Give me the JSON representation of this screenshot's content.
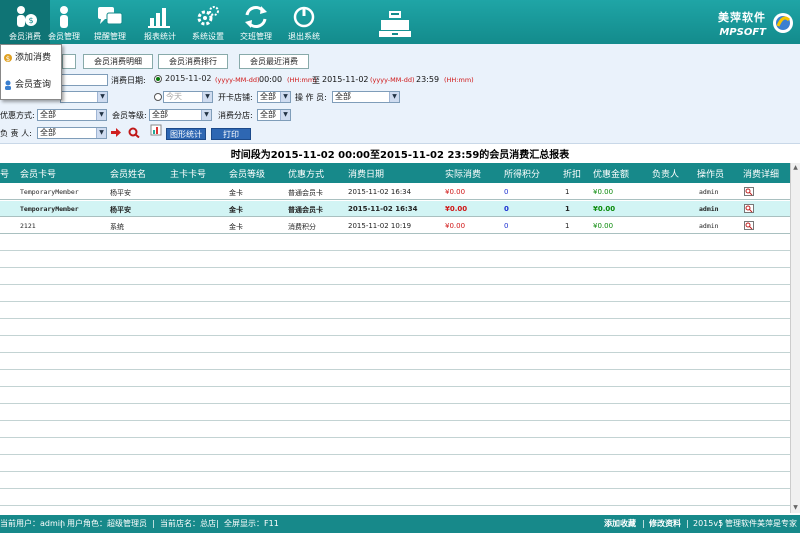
{
  "toolbar": {
    "items": [
      {
        "label": "会员消费",
        "icon": "member-consume-icon"
      },
      {
        "label": "会员管理",
        "icon": "member-manage-icon"
      },
      {
        "label": "提醒管理",
        "icon": "reminder-icon"
      },
      {
        "label": "报表统计",
        "icon": "report-chart-icon"
      },
      {
        "label": "系统设置",
        "icon": "settings-gear-icon"
      },
      {
        "label": "交班管理",
        "icon": "shift-handover-icon"
      },
      {
        "label": "退出系统",
        "icon": "exit-icon"
      }
    ],
    "brand_cn": "美萍软件",
    "brand_en": "MPSOFT"
  },
  "dropdown": {
    "items": [
      "添加消费",
      "会员查询"
    ]
  },
  "tabs": [
    "会员消费明细",
    "会员消费排行",
    "会员最近消费"
  ],
  "filters": {
    "consume_date_label": "消费日期:",
    "date_from": "2015-11-02",
    "date_fmt_hint": "(yyyy-MM-dd)",
    "time_from": "00:00",
    "time_fmt_hint": "(HH:mm)",
    "to_label": "至",
    "date_to": "2015-11-02",
    "time_to": "23:59",
    "today": "今天",
    "card_store_label": "开卡店铺:",
    "card_store_value": "全部",
    "operator_label": "操 作 员:",
    "operator_value": "全部",
    "discount_label": "优惠方式:",
    "discount_value": "全部",
    "level_label": "会员等级:",
    "level_value": "全部",
    "branch_label": "消费分店:",
    "branch_value": "全部",
    "person_label": "负 责 人:",
    "person_value": "全部",
    "chart_btn": "图形统计",
    "print_btn": "打印"
  },
  "report": {
    "title": "时间段为2015-11-02 00:00至2015-11-02 23:59的会员消费汇总报表",
    "columns": [
      "号",
      "会员卡号",
      "会员姓名",
      "主卡卡号",
      "会员等级",
      "优惠方式",
      "消费日期",
      "实际消费",
      "所得积分",
      "折扣",
      "优惠金额",
      "负责人",
      "操作员",
      "消费详细"
    ],
    "rows": [
      {
        "card": "TemporaryMember",
        "name": "杨平安",
        "main_card": "",
        "level": "金卡",
        "discount": "普通会员卡",
        "date": "2015-11-02 16:34",
        "actual": "¥0.00",
        "points": "0",
        "rate": "1",
        "saving": "¥0.00",
        "person": "",
        "operator": "admin"
      },
      {
        "card": "TemporaryMember",
        "name": "杨平安",
        "main_card": "",
        "level": "金卡",
        "discount": "普通会员卡",
        "date": "2015-11-02 16:34",
        "actual": "¥0.00",
        "points": "0",
        "rate": "1",
        "saving": "¥0.00",
        "person": "",
        "operator": "admin"
      },
      {
        "card": "2121",
        "name": "系统",
        "main_card": "",
        "level": "金卡",
        "discount": "消费积分",
        "date": "2015-11-02 10:19",
        "actual": "¥0.00",
        "points": "0",
        "rate": "1",
        "saving": "¥0.00",
        "person": "",
        "operator": "admin"
      }
    ]
  },
  "status": {
    "user": "当前用户：admin",
    "role": "用户角色：超级管理员",
    "store": "当前店名：总店",
    "fullscreen": "全屏显示：F11",
    "favorite": "添加收藏",
    "change_pwd": "修改资料",
    "version": "2015v5",
    "slogan": "管理软件美萍是专家"
  },
  "colors": {
    "accent": "#17898a",
    "selected_row": "#d2f4f4",
    "money_red": "#d01515",
    "money_green": "#0a8a0a"
  }
}
